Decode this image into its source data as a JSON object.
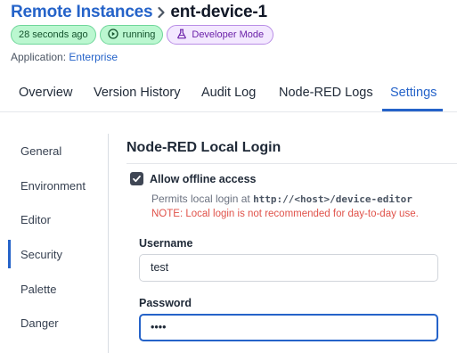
{
  "breadcrumb": {
    "parent": "Remote Instances",
    "current": "ent-device-1"
  },
  "badges": {
    "last_seen": "28 seconds ago",
    "status": "running",
    "mode": "Developer Mode"
  },
  "application": {
    "label": "Application:",
    "name": "Enterprise"
  },
  "tabs": [
    {
      "label": "Overview"
    },
    {
      "label": "Version History"
    },
    {
      "label": "Audit Log"
    },
    {
      "label": "Node-RED Logs"
    },
    {
      "label": "Settings"
    }
  ],
  "active_tab": "Settings",
  "sidebar": {
    "items": [
      {
        "label": "General"
      },
      {
        "label": "Environment"
      },
      {
        "label": "Editor"
      },
      {
        "label": "Security"
      },
      {
        "label": "Palette"
      },
      {
        "label": "Danger"
      }
    ],
    "active": "Security"
  },
  "section": {
    "title": "Node-RED Local Login",
    "offline_access": {
      "label": "Allow offline access",
      "checked": true,
      "help_prefix": "Permits local login at",
      "help_url": "http://<host>/device-editor",
      "warning": "NOTE: Local login is not recommended for day-to-day use."
    },
    "username": {
      "label": "Username",
      "value": "test"
    },
    "password": {
      "label": "Password",
      "value": "••••"
    }
  },
  "colors": {
    "accent": "#2563c9",
    "running_bg": "#bbf7d0",
    "developer_mode_bg": "#f3e8ff",
    "warning": "#e0524a"
  }
}
